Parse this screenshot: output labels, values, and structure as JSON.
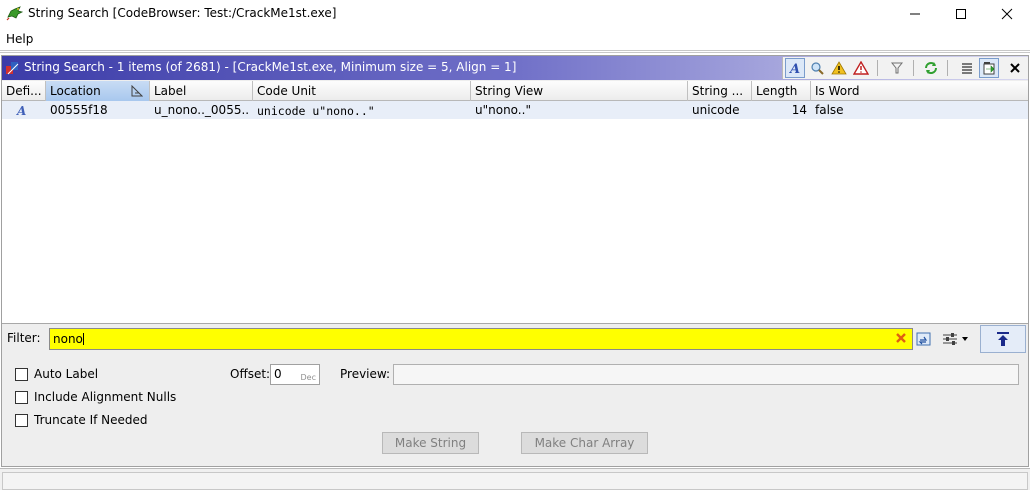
{
  "window": {
    "title": "String Search [CodeBrowser: Test:/CrackMe1st.exe]"
  },
  "menu": {
    "items": [
      "Help"
    ]
  },
  "panel": {
    "title": "String Search - 1 items (of 2681) - [CrackMe1st.exe, Minimum size = 5, Align = 1]",
    "header_gradient_start": "#3c3ca8",
    "toolbar_icons": [
      "defined-string-icon",
      "search-icon",
      "warning-icon",
      "error-icon",
      "filter-icon",
      "refresh-icon",
      "list-icon",
      "export-icon",
      "close-icon"
    ]
  },
  "table": {
    "columns": [
      "Defi...",
      "Location",
      "Label",
      "Code Unit",
      "String View",
      "String ...",
      "Length",
      "Is Word"
    ],
    "sorted_column": "Location",
    "rows": [
      {
        "defined_icon": "defined-string-icon",
        "location": "00555f18",
        "label": "u_nono.._0055...",
        "code_unit": "unicode u\"nono..\"",
        "string_view": "u\"nono..\"",
        "string_type": "unicode",
        "length": "14",
        "is_word": "false"
      }
    ]
  },
  "filter": {
    "label": "Filter:",
    "value": "nono",
    "highlight_color": "#ffff00"
  },
  "options": {
    "checkboxes": [
      {
        "label": "Auto Label",
        "checked": false
      },
      {
        "label": "Include Alignment Nulls",
        "checked": false
      },
      {
        "label": "Truncate If Needed",
        "checked": false
      }
    ],
    "offset_label": "Offset:",
    "offset_value": "0",
    "offset_radix": "Dec",
    "preview_label": "Preview:",
    "preview_value": "",
    "make_string_label": "Make String",
    "make_char_array_label": "Make Char Array"
  }
}
